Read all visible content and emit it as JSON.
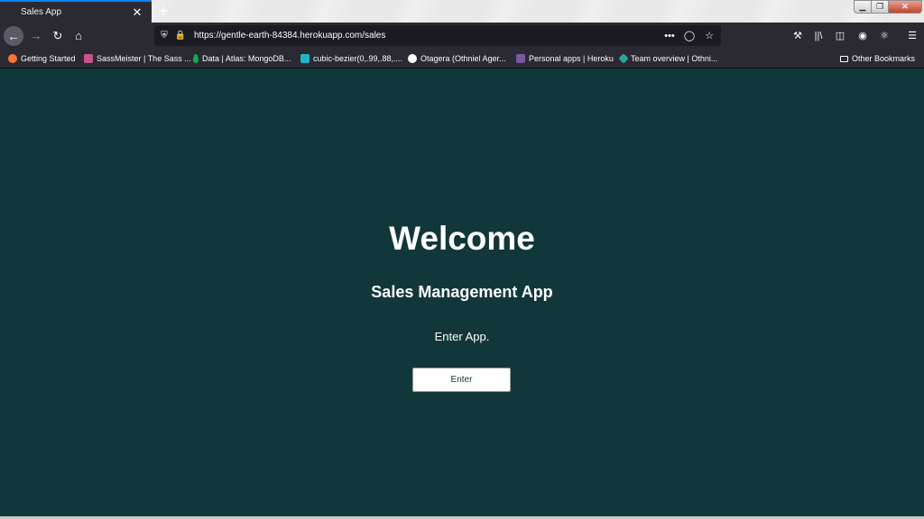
{
  "browser": {
    "tab_title": "Sales App",
    "tab_close": "✕",
    "new_tab": "+",
    "url": "https://gentle-earth-84384.herokuapp.com/sales",
    "page_actions": "•••",
    "window_controls": {
      "minimize": "▁",
      "maximize": "❐",
      "close": "✕"
    },
    "toolbar_icons": [
      "back-arrow-icon",
      "forward-arrow-icon",
      "reload-icon",
      "home-icon",
      "shield-icon",
      "lock-icon",
      "pocket-icon",
      "star-icon",
      "wrench-icon",
      "library-icon",
      "sidebar-icon",
      "account-icon",
      "react-devtools-icon",
      "hamburger-menu-icon"
    ]
  },
  "bookmarks": [
    {
      "label": "Getting Started",
      "color": "#ff7139"
    },
    {
      "label": "SassMeister | The Sass ...",
      "color": "#c6538c"
    },
    {
      "label": "Data | Atlas: MongoDB...",
      "color": "#13aa52"
    },
    {
      "label": "cubic-bezier(0,.99,.88,....",
      "color": "#1fb5c8"
    },
    {
      "label": "Otagera (Othniel Ager...",
      "color": "#ffffff"
    },
    {
      "label": "Personal apps | Heroku",
      "color": "#79589f"
    },
    {
      "label": "Team overview | Othni...",
      "color": "#26a69a"
    }
  ],
  "other_bookmarks": "Other Bookmarks",
  "page": {
    "background": "#12373a",
    "heading": "Welcome",
    "subtitle": "Sales Management App",
    "prompt": "Enter App.",
    "enter_button": "Enter"
  }
}
